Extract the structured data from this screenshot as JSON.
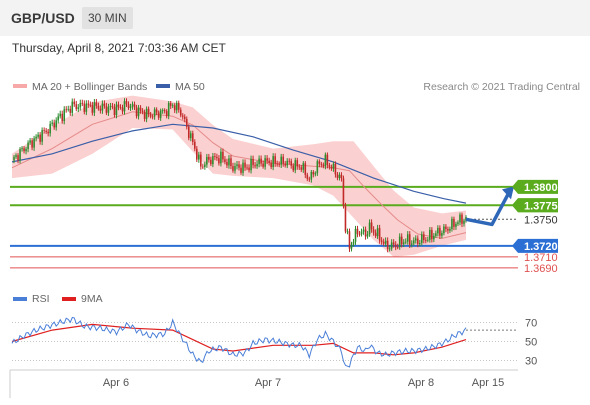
{
  "header": {
    "symbol": "GBP/USD",
    "timeframe": "30 MIN",
    "datetime": "Thursday, April 8, 2021 7:03:36 AM CET"
  },
  "legend": {
    "bb_label": "MA 20 + Bollinger Bands",
    "ma50_label": "MA 50",
    "credit": "Research © 2021 Trading Central"
  },
  "colors": {
    "up": "#2e8b2e",
    "down": "#c22a2a",
    "bb": "#f7a9a9",
    "ma20": "#e58a8a",
    "ma50": "#3a5fa8",
    "resistance": "#5aac1e",
    "support": "#2b6fd4",
    "support_red": "#e05050",
    "rsi": "#4a7fd8",
    "rsi_ma": "#e02020",
    "arrow": "#2f67b8"
  },
  "chart_data": [
    {
      "type": "candlestick",
      "title": "",
      "x_ticks": [
        "Apr 6",
        "Apr 7",
        "Apr 8",
        "Apr 15"
      ],
      "levels": [
        {
          "value": 1.38,
          "label": "1.3800",
          "kind": "resistance"
        },
        {
          "value": 1.3775,
          "label": "1.3775",
          "kind": "resistance"
        },
        {
          "value": 1.372,
          "label": "1.3720",
          "kind": "support"
        },
        {
          "value": 1.3705,
          "label": "1.3710",
          "kind": "support-red"
        },
        {
          "value": 1.369,
          "label": "1.3690",
          "kind": "support-red"
        }
      ],
      "last_price_label": "1.3750",
      "forecast": {
        "via": 1.3749,
        "target": 1.3798
      },
      "ylim": [
        1.366,
        1.3918
      ],
      "anchors": [
        [
          0,
          1.3836
        ],
        [
          6,
          1.3852
        ],
        [
          12,
          1.3866
        ],
        [
          18,
          1.3878
        ],
        [
          24,
          1.3896
        ],
        [
          30,
          1.391
        ],
        [
          36,
          1.391
        ],
        [
          44,
          1.3908
        ],
        [
          52,
          1.3906
        ],
        [
          58,
          1.3912
        ],
        [
          62,
          1.3904
        ],
        [
          68,
          1.3898
        ],
        [
          76,
          1.3902
        ],
        [
          80,
          1.3912
        ],
        [
          84,
          1.3902
        ],
        [
          90,
          1.386
        ],
        [
          94,
          1.3828
        ],
        [
          98,
          1.3837
        ],
        [
          104,
          1.384
        ],
        [
          110,
          1.3827
        ],
        [
          116,
          1.3826
        ],
        [
          120,
          1.3831
        ],
        [
          126,
          1.3834
        ],
        [
          132,
          1.3833
        ],
        [
          136,
          1.3834
        ],
        [
          140,
          1.3829
        ],
        [
          144,
          1.3828
        ],
        [
          148,
          1.381
        ],
        [
          152,
          1.3829
        ],
        [
          156,
          1.3835
        ],
        [
          160,
          1.3824
        ],
        [
          164,
          1.3809
        ],
        [
          166,
          1.3745
        ],
        [
          168,
          1.3718
        ],
        [
          172,
          1.374
        ],
        [
          176,
          1.3736
        ],
        [
          178,
          1.3745
        ],
        [
          182,
          1.3735
        ],
        [
          186,
          1.372
        ],
        [
          190,
          1.372
        ],
        [
          196,
          1.3728
        ],
        [
          200,
          1.3725
        ],
        [
          206,
          1.373
        ],
        [
          212,
          1.3738
        ],
        [
          216,
          1.3742
        ],
        [
          220,
          1.375
        ],
        [
          224,
          1.3756
        ]
      ],
      "ma20": [
        [
          0,
          1.3826
        ],
        [
          20,
          1.3852
        ],
        [
          40,
          1.3885
        ],
        [
          60,
          1.3902
        ],
        [
          80,
          1.3896
        ],
        [
          90,
          1.3884
        ],
        [
          100,
          1.386
        ],
        [
          110,
          1.3842
        ],
        [
          130,
          1.3832
        ],
        [
          150,
          1.3828
        ],
        [
          160,
          1.3826
        ],
        [
          168,
          1.3822
        ],
        [
          176,
          1.3798
        ],
        [
          184,
          1.3776
        ],
        [
          192,
          1.3755
        ],
        [
          202,
          1.3736
        ],
        [
          214,
          1.373
        ],
        [
          226,
          1.3738
        ]
      ],
      "ma50": [
        [
          0,
          1.3834
        ],
        [
          20,
          1.3845
        ],
        [
          40,
          1.3862
        ],
        [
          60,
          1.3876
        ],
        [
          80,
          1.3885
        ],
        [
          100,
          1.388
        ],
        [
          120,
          1.3868
        ],
        [
          140,
          1.385
        ],
        [
          160,
          1.3834
        ],
        [
          180,
          1.3812
        ],
        [
          200,
          1.3794
        ],
        [
          215,
          1.3784
        ],
        [
          226,
          1.3778
        ]
      ],
      "bb_upper": [
        [
          0,
          1.3845
        ],
        [
          20,
          1.3882
        ],
        [
          40,
          1.3915
        ],
        [
          60,
          1.3924
        ],
        [
          80,
          1.3916
        ],
        [
          90,
          1.3908
        ],
        [
          100,
          1.3884
        ],
        [
          110,
          1.3865
        ],
        [
          130,
          1.3852
        ],
        [
          150,
          1.3858
        ],
        [
          160,
          1.3862
        ],
        [
          170,
          1.3862
        ],
        [
          180,
          1.3828
        ],
        [
          190,
          1.3795
        ],
        [
          200,
          1.3772
        ],
        [
          214,
          1.3764
        ],
        [
          226,
          1.3768
        ]
      ],
      "bb_lower": [
        [
          0,
          1.3812
        ],
        [
          20,
          1.3818
        ],
        [
          40,
          1.3845
        ],
        [
          60,
          1.388
        ],
        [
          80,
          1.3878
        ],
        [
          90,
          1.3848
        ],
        [
          100,
          1.3818
        ],
        [
          110,
          1.3815
        ],
        [
          130,
          1.3812
        ],
        [
          150,
          1.3802
        ],
        [
          160,
          1.3788
        ],
        [
          170,
          1.3758
        ],
        [
          180,
          1.3728
        ],
        [
          190,
          1.3705
        ],
        [
          200,
          1.3708
        ],
        [
          214,
          1.372
        ],
        [
          226,
          1.3728
        ]
      ]
    },
    {
      "type": "line",
      "title": "RSI",
      "legend": [
        "RSI",
        "9MA"
      ],
      "ylim": [
        20,
        80
      ],
      "y_ticks": [
        70,
        50,
        30
      ],
      "rsi": [
        [
          0,
          48
        ],
        [
          6,
          56
        ],
        [
          12,
          62
        ],
        [
          18,
          66
        ],
        [
          24,
          70
        ],
        [
          30,
          74
        ],
        [
          36,
          66
        ],
        [
          44,
          64
        ],
        [
          52,
          60
        ],
        [
          58,
          68
        ],
        [
          62,
          62
        ],
        [
          68,
          56
        ],
        [
          76,
          58
        ],
        [
          80,
          70
        ],
        [
          84,
          56
        ],
        [
          90,
          36
        ],
        [
          94,
          28
        ],
        [
          98,
          40
        ],
        [
          104,
          44
        ],
        [
          110,
          36
        ],
        [
          116,
          38
        ],
        [
          120,
          48
        ],
        [
          126,
          52
        ],
        [
          132,
          50
        ],
        [
          136,
          48
        ],
        [
          140,
          46
        ],
        [
          144,
          46
        ],
        [
          148,
          36
        ],
        [
          152,
          52
        ],
        [
          156,
          58
        ],
        [
          160,
          50
        ],
        [
          164,
          40
        ],
        [
          166,
          22
        ],
        [
          168,
          26
        ],
        [
          172,
          44
        ],
        [
          176,
          40
        ],
        [
          178,
          46
        ],
        [
          182,
          38
        ],
        [
          186,
          36
        ],
        [
          190,
          38
        ],
        [
          196,
          40
        ],
        [
          200,
          40
        ],
        [
          206,
          42
        ],
        [
          212,
          46
        ],
        [
          216,
          50
        ],
        [
          220,
          56
        ],
        [
          226,
          62
        ]
      ],
      "rsi_ma": [
        [
          0,
          50
        ],
        [
          20,
          62
        ],
        [
          40,
          68
        ],
        [
          60,
          64
        ],
        [
          80,
          62
        ],
        [
          90,
          52
        ],
        [
          100,
          42
        ],
        [
          110,
          40
        ],
        [
          130,
          46
        ],
        [
          150,
          46
        ],
        [
          160,
          48
        ],
        [
          170,
          38
        ],
        [
          180,
          38
        ],
        [
          190,
          36
        ],
        [
          200,
          38
        ],
        [
          214,
          44
        ],
        [
          226,
          52
        ]
      ]
    }
  ]
}
